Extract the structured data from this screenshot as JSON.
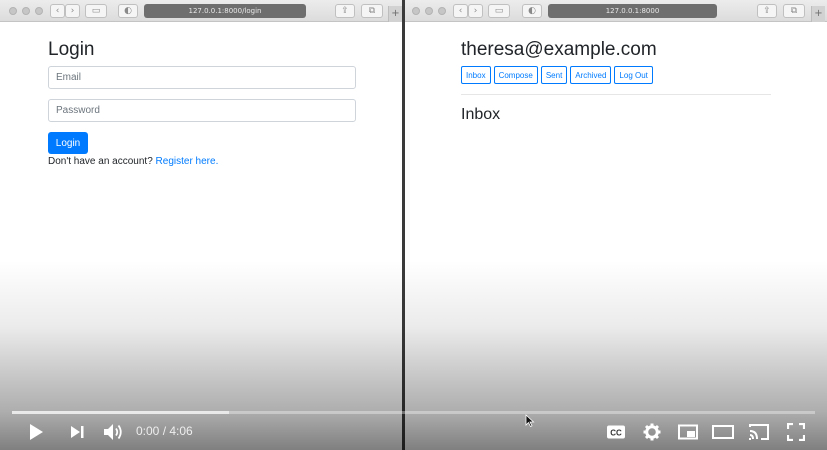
{
  "left_window": {
    "url": "127.0.0.1:8000/login",
    "login_title": "Login",
    "email_placeholder": "Email",
    "email_value": "",
    "password_placeholder": "Password",
    "password_value": "",
    "login_button": "Login",
    "register_prompt": "Don't have an account?",
    "register_link": "Register here."
  },
  "right_window": {
    "url": "127.0.0.1:8000",
    "user_email": "theresa@example.com",
    "nav": [
      "Inbox",
      "Compose",
      "Sent",
      "Archived",
      "Log Out"
    ],
    "section_title": "Inbox"
  },
  "player": {
    "time_display": "0:00 / 4:06",
    "played_fraction": 0.0,
    "buffered_fraction": 0.27,
    "cc_label": "CC",
    "accent_color": "#ff0000"
  },
  "colors": {
    "primary": "#007bff"
  }
}
